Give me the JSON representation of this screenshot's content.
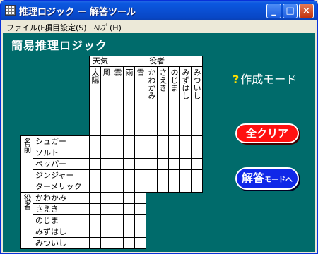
{
  "window": {
    "title": "推理ロジック － 解答ツール",
    "min_glyph": "_",
    "max_glyph": "□",
    "close_glyph": "×"
  },
  "menu": [
    {
      "label": "ファイル(F)"
    },
    {
      "label": "項目設定(S)"
    },
    {
      "label": "ﾍﾙﾌﾟ(H)"
    }
  ],
  "heading": "簡易推理ロジック",
  "grid": {
    "col_groups": [
      {
        "label": "天気",
        "items": [
          "太陽",
          "風",
          "雲",
          "雨",
          "雪"
        ]
      },
      {
        "label": "役者",
        "items": [
          "かわかみ",
          "さえき",
          "のじま",
          "みずはし",
          "みついし"
        ]
      }
    ],
    "row_groups": [
      {
        "label": "名前",
        "items": [
          "シュガー",
          "ソルト",
          "ペッパー",
          "ジンジャー",
          "ターメリック"
        ]
      },
      {
        "label": "役者",
        "items": [
          "かわかみ",
          "さえき",
          "のじま",
          "みずはし",
          "みついし"
        ]
      }
    ]
  },
  "mode": {
    "icon": "question-icon",
    "icon_glyph": "?",
    "label": "作成モード"
  },
  "buttons": {
    "clear": "全クリア",
    "answer_main": "解答",
    "answer_sub": "モードへ"
  },
  "colors": {
    "client_bg": "#006b6b",
    "clear_button": "#ff1010",
    "answer_button": "#1028e8",
    "title_bar": "#0a4fd3"
  }
}
